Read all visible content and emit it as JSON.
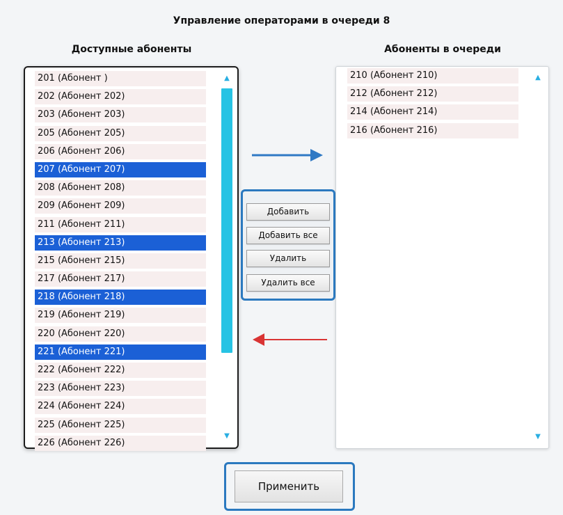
{
  "title": "Управление операторами в очереди 8",
  "available": {
    "title": "Доступные абоненты",
    "items": [
      {
        "label": "201 (Абонент )",
        "selected": false
      },
      {
        "label": "202 (Абонент 202)",
        "selected": false
      },
      {
        "label": "203 (Абонент 203)",
        "selected": false
      },
      {
        "label": "205 (Абонент 205)",
        "selected": false
      },
      {
        "label": "206 (Абонент 206)",
        "selected": false
      },
      {
        "label": "207 (Абонент 207)",
        "selected": true
      },
      {
        "label": "208 (Абонент 208)",
        "selected": false
      },
      {
        "label": "209 (Абонент 209)",
        "selected": false
      },
      {
        "label": "211 (Абонент 211)",
        "selected": false
      },
      {
        "label": "213 (Абонент 213)",
        "selected": true
      },
      {
        "label": "215 (Абонент 215)",
        "selected": false
      },
      {
        "label": "217 (Абонент 217)",
        "selected": false
      },
      {
        "label": "218 (Абонент 218)",
        "selected": true
      },
      {
        "label": "219 (Абонент 219)",
        "selected": false
      },
      {
        "label": "220 (Абонент 220)",
        "selected": false
      },
      {
        "label": "221 (Абонент 221)",
        "selected": true
      },
      {
        "label": "222 (Абонент 222)",
        "selected": false
      },
      {
        "label": "223 (Абонент 223)",
        "selected": false
      },
      {
        "label": "224 (Абонент 224)",
        "selected": false
      },
      {
        "label": "225 (Абонент 225)",
        "selected": false
      },
      {
        "label": "226 (Абонент 226)",
        "selected": false
      }
    ]
  },
  "queue": {
    "title": "Абоненты в очереди",
    "items": [
      {
        "label": "210 (Абонент 210)",
        "selected": false
      },
      {
        "label": "212 (Абонент 212)",
        "selected": false
      },
      {
        "label": "214 (Абонент 214)",
        "selected": false
      },
      {
        "label": "216 (Абонент 216)",
        "selected": false
      }
    ]
  },
  "buttons": {
    "add": "Добавить",
    "add_all": "Добавить все",
    "remove": "Удалить",
    "remove_all": "Удалить все",
    "apply": "Применить"
  },
  "icons": {
    "scroll_up": "scroll-up-icon",
    "scroll_down": "scroll-down-icon",
    "arrow_right": "arrow-right-icon",
    "arrow_left": "arrow-left-icon"
  },
  "colors": {
    "selection": "#1b60d6",
    "scroll_thumb": "#27c3e4",
    "arrow_right": "#2f79c4",
    "arrow_left": "#d93434",
    "highlight_frame": "#2b79bf"
  }
}
